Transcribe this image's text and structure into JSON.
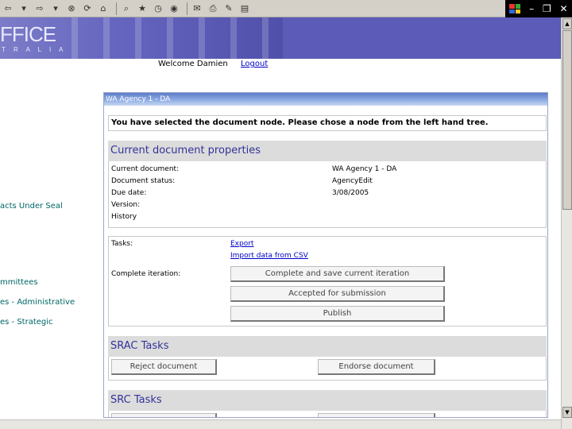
{
  "banner": {
    "title": "FFICE",
    "subtitle": "T R A L I A"
  },
  "header": {
    "welcome": "Welcome Damien",
    "logout": "Logout"
  },
  "nav": [
    "acts Under Seal",
    "mmittees",
    "es - Administrative",
    "es - Strategic"
  ],
  "panel": {
    "title": "WA Agency 1 - DA",
    "message": "You have selected the document node. Please chose a node from the left hand tree."
  },
  "properties": {
    "heading": "Current document properties",
    "rows": [
      {
        "label": "Current document:",
        "value": "WA Agency 1 - DA"
      },
      {
        "label": "Document status:",
        "value": "AgencyEdit"
      },
      {
        "label": "Due date:",
        "value": "3/08/2005"
      },
      {
        "label": "Version:",
        "value": ""
      },
      {
        "label": "History",
        "value": ""
      }
    ]
  },
  "tasks": {
    "tasks_label": "Tasks:",
    "export_link": "Export",
    "import_link": "Import data from CSV",
    "iteration_label": "Complete iteration:",
    "complete_btn": "Complete and save current iteration",
    "accepted_btn": "Accepted for submission",
    "publish_btn": "Publish"
  },
  "srac": {
    "heading": "SRAC Tasks",
    "reject_btn": "Reject document",
    "endorse_btn": "Endorse document"
  },
  "src": {
    "heading": "SRC Tasks"
  },
  "colors": {
    "banner": "#5d5bb8",
    "heading_text": "#333399",
    "link": "#0000cc",
    "nav_link": "#006666"
  }
}
